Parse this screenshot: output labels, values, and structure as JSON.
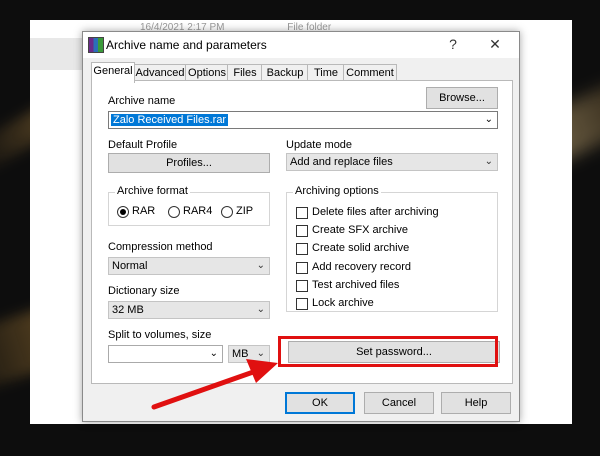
{
  "background": {
    "date_text": "16/4/2021 2:17 PM",
    "type_text": "File folder"
  },
  "dialog": {
    "title": "Archive name and parameters",
    "help_glyph": "?",
    "close_glyph": "✕",
    "tabs": [
      "General",
      "Advanced",
      "Options",
      "Files",
      "Backup",
      "Time",
      "Comment"
    ],
    "archive_name_label": "Archive name",
    "browse_button": "Browse...",
    "archive_name_value": "Zalo Received Files.rar",
    "default_profile_label": "Default Profile",
    "profiles_button": "Profiles...",
    "update_mode_label": "Update mode",
    "update_mode_value": "Add and replace files",
    "archive_format_label": "Archive format",
    "formats": [
      "RAR",
      "RAR4",
      "ZIP"
    ],
    "selected_format": "RAR",
    "archiving_options_label": "Archiving options",
    "options": [
      "Delete files after archiving",
      "Create SFX archive",
      "Create solid archive",
      "Add recovery record",
      "Test archived files",
      "Lock archive"
    ],
    "compression_method_label": "Compression method",
    "compression_method_value": "Normal",
    "dictionary_size_label": "Dictionary size",
    "dictionary_size_value": "32 MB",
    "split_label": "Split to volumes, size",
    "split_value": "",
    "split_unit": "MB",
    "set_password_button": "Set password...",
    "ok_button": "OK",
    "cancel_button": "Cancel",
    "help_button": "Help"
  },
  "colors": {
    "highlight_box": "#e01010",
    "arrow": "#e01010",
    "selection": "#0078d7"
  }
}
